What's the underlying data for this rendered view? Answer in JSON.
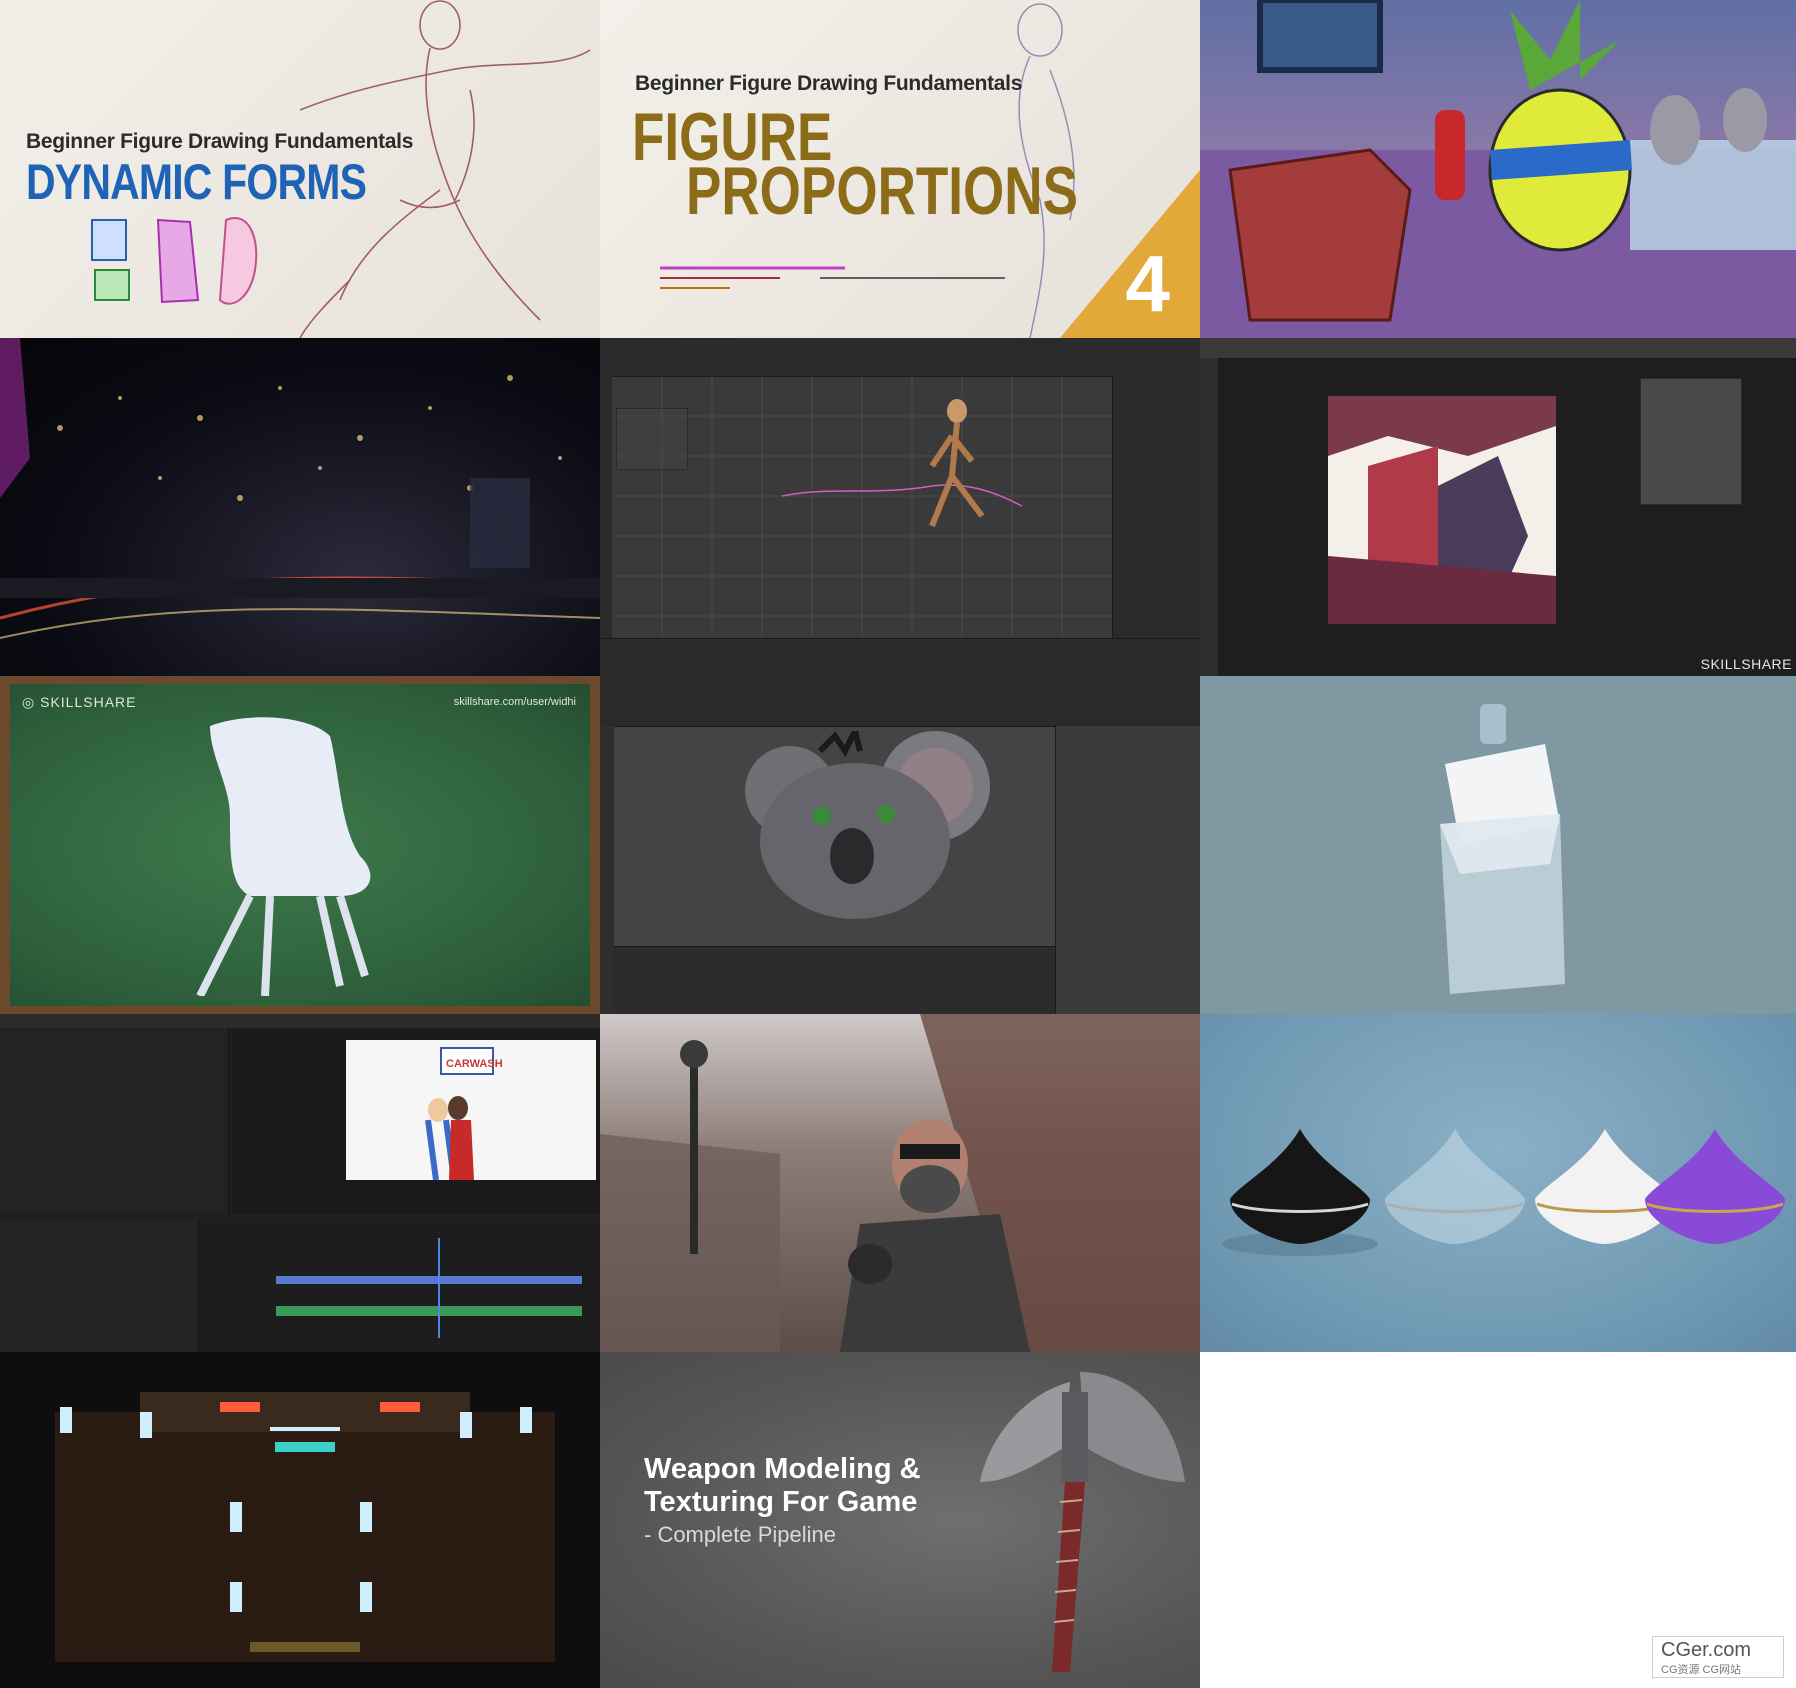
{
  "tiles": {
    "dynamic_forms": {
      "subtitle": "Beginner Figure Drawing Fundamentals",
      "title": "DYNAMIC FORMS"
    },
    "figure_proportions": {
      "subtitle": "Beginner Figure Drawing Fundamentals",
      "title_line1": "FIGURE",
      "title_line2": "PROPORTIONS",
      "episode_number": "4"
    },
    "photoshop": {
      "watermark": "SKILLSHARE"
    },
    "chair": {
      "brand": "SKILLSHARE",
      "url": "skillshare.com/user/widhi"
    },
    "premiere": {
      "sign_text": "CARWASH"
    },
    "weapon": {
      "title_line1": "Weapon Modeling &",
      "title_line2": "Texturing For Game",
      "subtitle": "- Complete Pipeline"
    }
  },
  "watermark": {
    "site": "CGer.com",
    "tagline": "CG资源 CG网站"
  }
}
